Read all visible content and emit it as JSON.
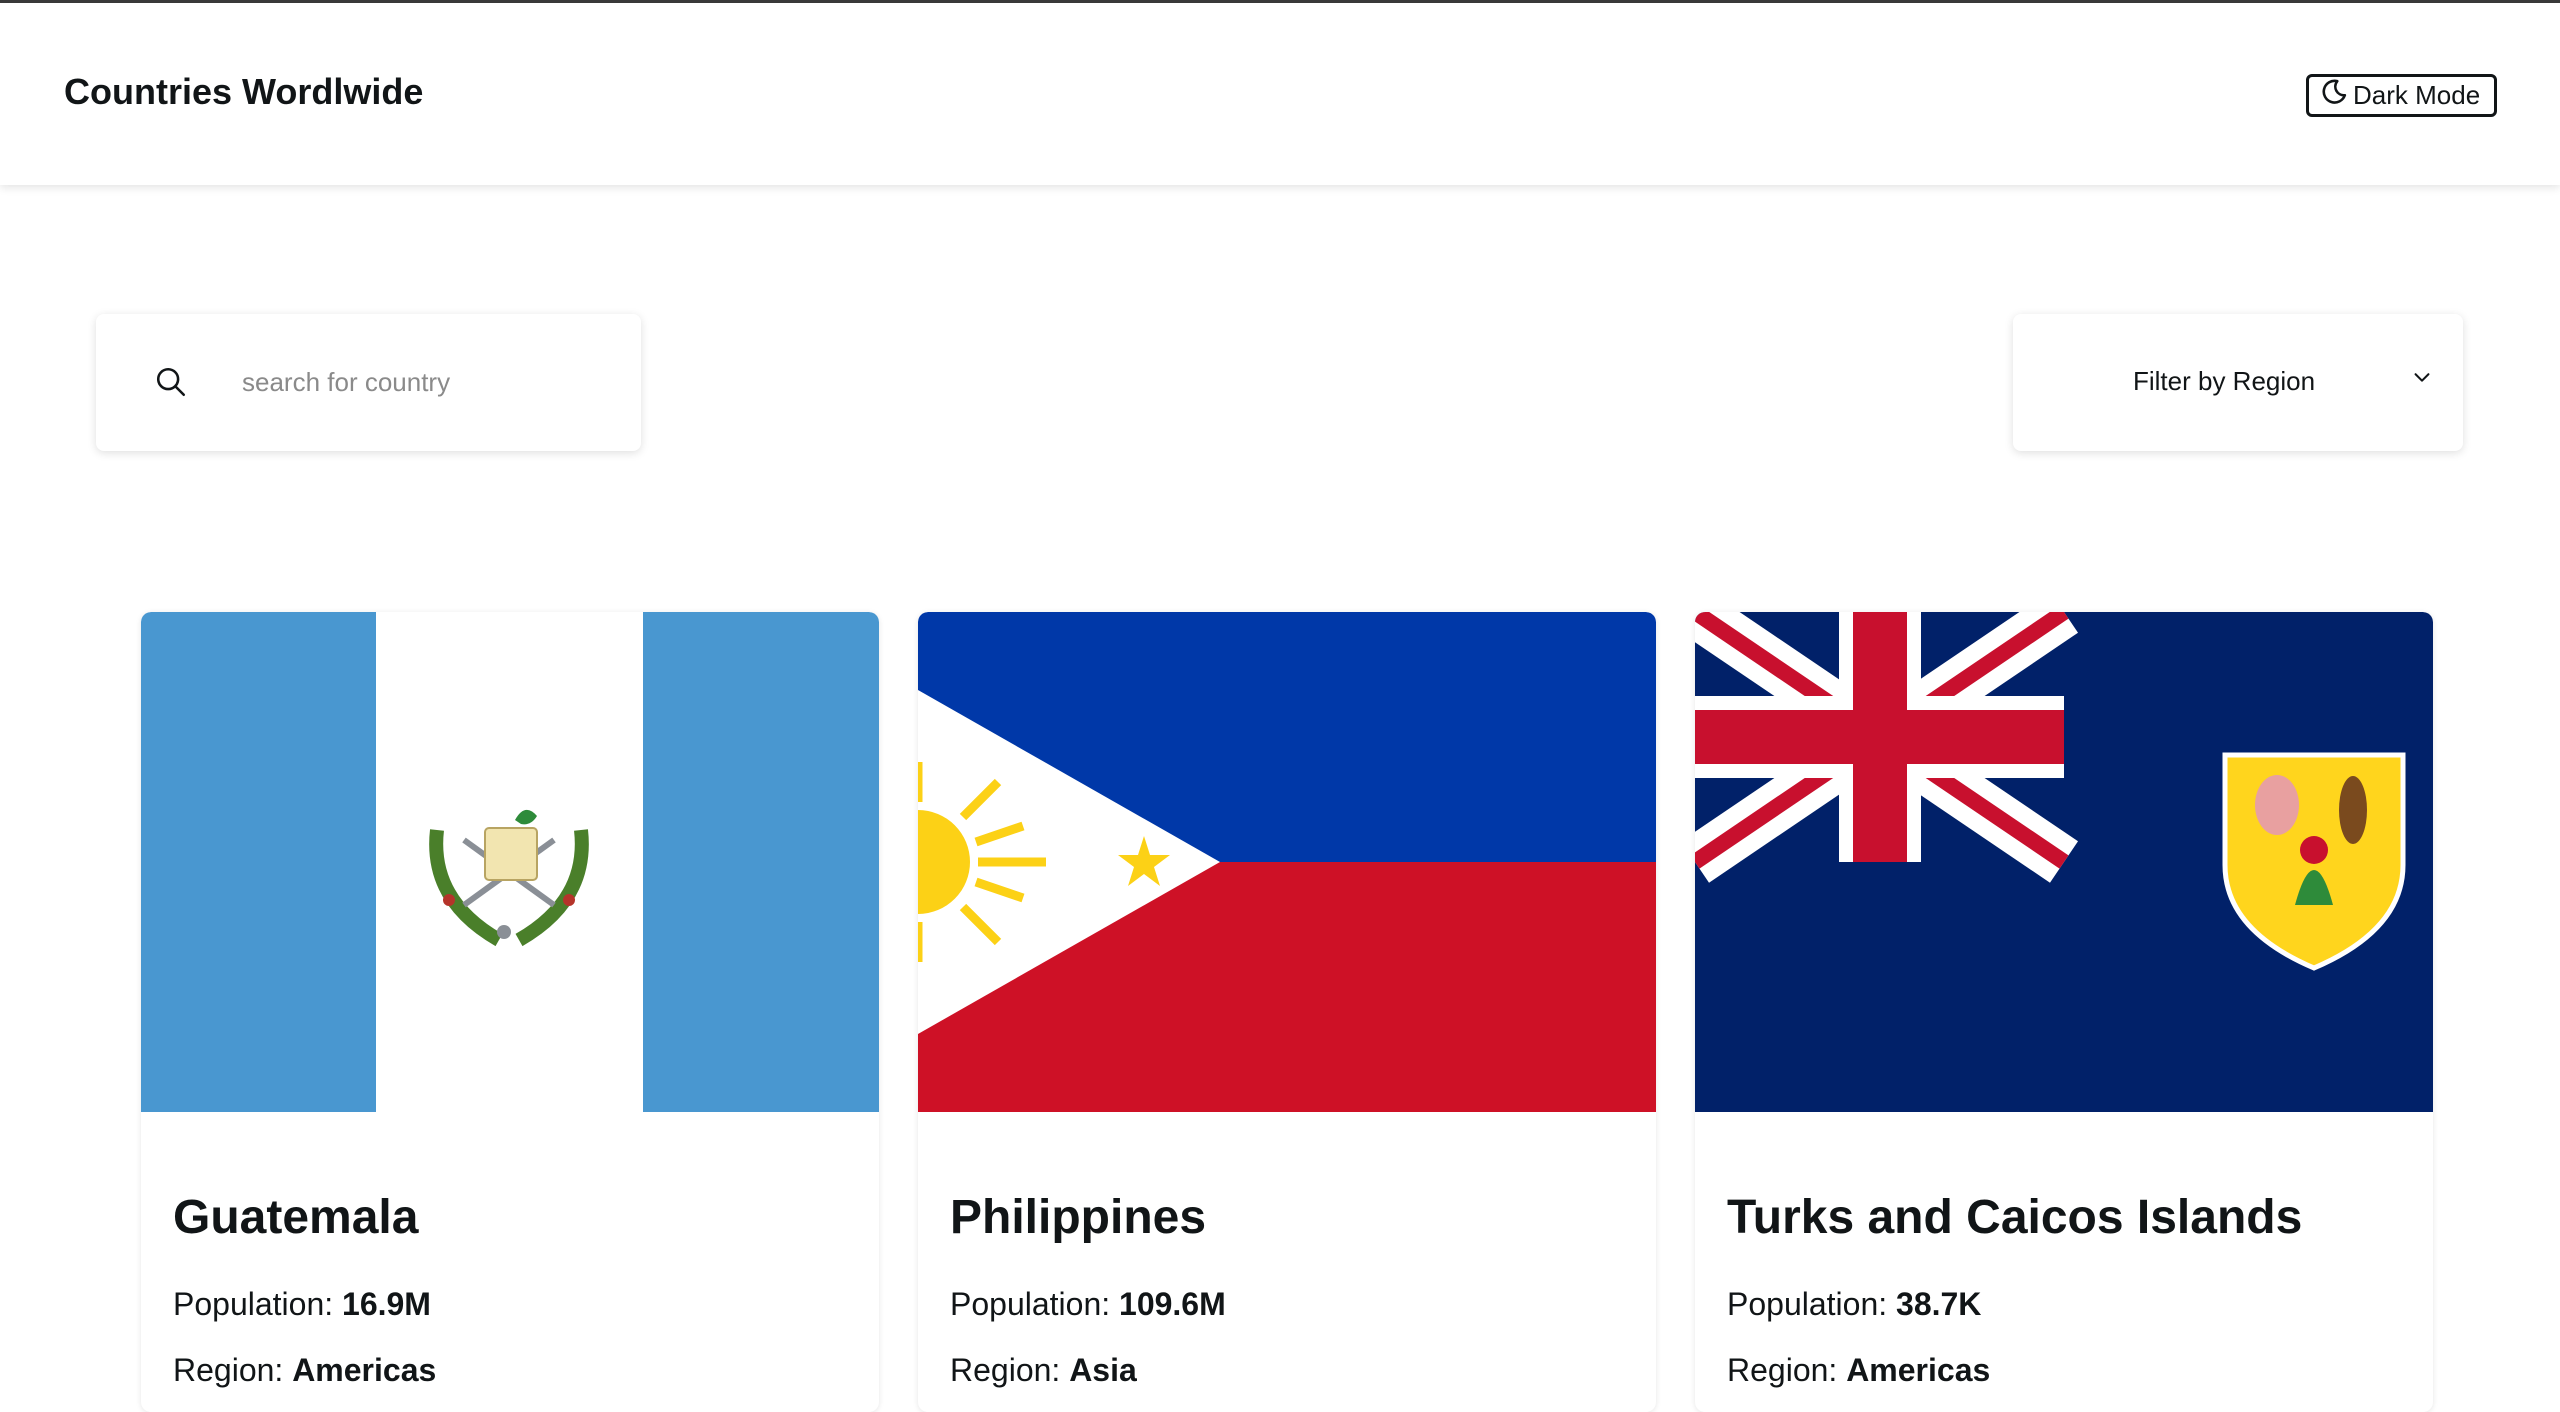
{
  "header": {
    "title": "Countries Wordlwide",
    "dark_mode_label": "Dark Mode"
  },
  "search": {
    "placeholder": "search for country",
    "value": ""
  },
  "filter": {
    "label": "Filter by Region"
  },
  "countries": [
    {
      "name": "Guatemala",
      "population_label": "Population:",
      "population": "16.9M",
      "region_label": "Region:",
      "region": "Americas",
      "flag": "guatemala-flag"
    },
    {
      "name": "Philippines",
      "population_label": "Population:",
      "population": "109.6M",
      "region_label": "Region:",
      "region": "Asia",
      "flag": "philippines-flag"
    },
    {
      "name": "Turks and Caicos Islands",
      "population_label": "Population:",
      "population": "38.7K",
      "region_label": "Region:",
      "region": "Americas",
      "flag": "turks-and-caicos-flag"
    }
  ],
  "colors": {
    "text": "#111517",
    "guatemala_blue": "#4997D0",
    "ph_blue": "#0038A8",
    "ph_red": "#CE1126",
    "ph_yellow": "#FCD116",
    "tc_navy": "#012169",
    "tc_red": "#C8102E",
    "tc_shield": "#FFD51D"
  }
}
